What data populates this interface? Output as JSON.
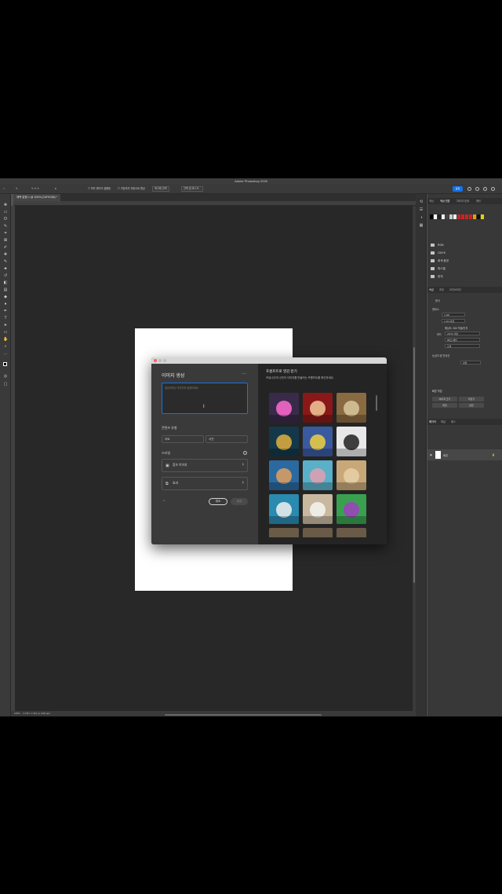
{
  "app": {
    "title": "Adobe Photoshop 2025",
    "share_label": "공유"
  },
  "options_bar": {
    "sample_all_layers": "모든 레이어 샘플링",
    "auto_enhance": "가장자리 자동으로 향상",
    "select_subject": "피사체 선택",
    "select_and_mask": "선택 및 마스크..."
  },
  "document": {
    "tab_label": "제목 없음-1 @ 100% (CMYK/8#) *",
    "status": "100%",
    "status_info": "1 035 x 1 613 px (300 ppi)"
  },
  "right_panel": {
    "top_tabs": [
      "색상",
      "색상 견본",
      "그레이디언트",
      "패턴"
    ],
    "folders": [
      "RGB",
      "CMYK",
      "회색 음영",
      "파스텔",
      "밝게"
    ],
    "prop_tabs": [
      "속성",
      "조정",
      "라이브러리"
    ],
    "doc_label": "문서",
    "canvas_label": "캔버스",
    "width_value": "1 035",
    "height_value": "1 613 픽셀",
    "resolution_label": "해상도: 300 픽셀/인치",
    "mode_label": "모드",
    "mode_value": "CMYK 색상",
    "bit_value": "8비트/채널",
    "fill_value": "흰색",
    "guides_label": "눈금자 및 안내선",
    "guides_unit": "픽셀",
    "quick_actions_label": "빠른 작업",
    "qa_buttons": [
      "이미지 크기",
      "자르기",
      "회전",
      "반전"
    ],
    "layer_tabs": [
      "레이어",
      "채널",
      "패스"
    ],
    "layer_name": "배경"
  },
  "dialog": {
    "title": "이미지 생성",
    "prompt_placeholder": "생성하려는 이미지를 설명하세요",
    "content_type_label": "콘텐츠 유형",
    "content_types": [
      "아트",
      "사진"
    ],
    "styles_label": "스타일",
    "reference_label": "참조 이미지",
    "effects_label": "효과",
    "cancel_label": "취소",
    "generate_label": "생성",
    "right_title": "프롬프트로 영감 받기",
    "right_subtitle": "커뮤니티의 나만의 이미지를 만들려는 프롬프트를 확인하세요.",
    "thumbnails": [
      {
        "name": "party-lights",
        "bg": "#3a2a4a",
        "accent": "#ff6bd0"
      },
      {
        "name": "milkshake",
        "bg": "#8a1818",
        "accent": "#f2c89a"
      },
      {
        "name": "vases",
        "bg": "#8a6a40",
        "accent": "#d8c8a0"
      },
      {
        "name": "fantasy-city",
        "bg": "#14384a",
        "accent": "#e0b040"
      },
      {
        "name": "soccer-player",
        "bg": "#3a5aa0",
        "accent": "#f0d040"
      },
      {
        "name": "tree-emblem",
        "bg": "#e8e8e8",
        "accent": "#202020"
      },
      {
        "name": "cartoon-girl",
        "bg": "#2a6aa0",
        "accent": "#e0a060"
      },
      {
        "name": "tropical-beach",
        "bg": "#5ab0c8",
        "accent": "#e0a0b0"
      },
      {
        "name": "desert-castle",
        "bg": "#c8a878",
        "accent": "#e8d0a8"
      },
      {
        "name": "coffee-cup",
        "bg": "#2a8ab0",
        "accent": "#f0f0f0"
      },
      {
        "name": "paper-note",
        "bg": "#c8b8a0",
        "accent": "#f4f4f0"
      },
      {
        "name": "neon-horse",
        "bg": "#3aa050",
        "accent": "#a040c0"
      }
    ]
  }
}
